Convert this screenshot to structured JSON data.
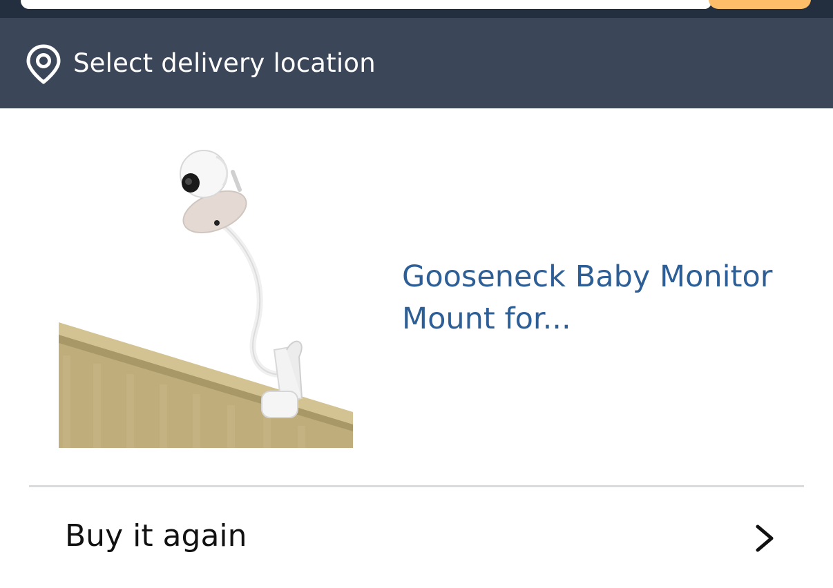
{
  "header": {
    "search_placeholder": "",
    "search_button_color": "#febd69"
  },
  "delivery": {
    "icon": "location-pin-icon",
    "label": "Select delivery location"
  },
  "product": {
    "title": "Gooseneck Baby Monitor Mount for...",
    "image": "baby-monitor-mount-image"
  },
  "buy_again": {
    "label": "Buy it again",
    "icon": "chevron-right-icon"
  },
  "colors": {
    "top_bar": "#232f3e",
    "delivery_bar": "#3b4759",
    "link": "#2d5f96"
  }
}
